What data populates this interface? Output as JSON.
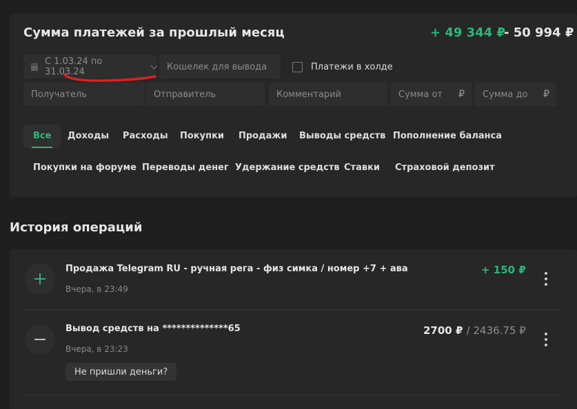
{
  "summary": {
    "title": "Сумма платежей за прошлый месяц",
    "income": "+ 49 344 ₽",
    "expense": "- 50 994 ₽",
    "colors": {
      "positive": "#2bb77a",
      "underline": "#e02020"
    }
  },
  "filters": {
    "date_range": "С 1.03.24 по 31.03.24",
    "wallet_placeholder": "Кошелек для вывода",
    "hold_label": "Платежи в холде",
    "recipient_placeholder": "Получатель",
    "sender_placeholder": "Отправитель",
    "comment_placeholder": "Комментарий",
    "sum_from_placeholder": "Сумма от",
    "sum_to_placeholder": "Сумма до",
    "currency": "₽"
  },
  "tabs": [
    "Все",
    "Доходы",
    "Расходы",
    "Покупки",
    "Продажи",
    "Выводы средств",
    "Пополнение баланса",
    "Покупки на форуме",
    "Переводы денег",
    "Удержание средств",
    "Ставки",
    "Страховой депозит"
  ],
  "history": {
    "title": "История операций",
    "items": [
      {
        "icon": "plus-icon",
        "title": "Продажа Telegram RU - ручная рега - физ симка / номер +7 + ава",
        "time": "Вчера, в 23:49",
        "amount": "+ 150 ₽"
      },
      {
        "icon": "minus-icon",
        "title": "Вывод средств на **************65",
        "time": "Вчера, в 23:23",
        "amount": "2700 ₽",
        "amount_net": "/ 2436.75 ₽",
        "action": "Не пришли деньги?"
      }
    ]
  }
}
